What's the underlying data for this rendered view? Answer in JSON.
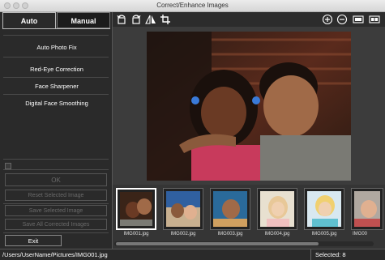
{
  "window": {
    "title": "Correct/Enhance Images"
  },
  "tabs": {
    "auto": "Auto",
    "manual": "Manual"
  },
  "corrections": {
    "auto_photo_fix": "Auto Photo Fix",
    "red_eye": "Red-Eye Correction",
    "face_sharpener": "Face Sharpener",
    "digital_face_smoothing": "Digital Face Smoothing"
  },
  "buttons": {
    "ok": "OK",
    "reset_selected": "Reset Selected Image",
    "save_selected": "Save Selected Image",
    "save_all": "Save All Corrected Images",
    "exit": "Exit"
  },
  "toolbar": {
    "icons": [
      "rotate-left-icon",
      "rotate-right-icon",
      "flip-icon",
      "crop-icon",
      "zoom-in-icon",
      "zoom-out-icon",
      "single-view-icon",
      "compare-view-icon"
    ]
  },
  "thumbnails": [
    {
      "label": "IMG001.jpg",
      "selected": true
    },
    {
      "label": "IMG002.jpg",
      "selected": false
    },
    {
      "label": "IMG003.jpg",
      "selected": false
    },
    {
      "label": "IMG004.jpg",
      "selected": false
    },
    {
      "label": "IMG005.jpg",
      "selected": false
    },
    {
      "label": "IMG00",
      "selected": false
    }
  ],
  "status": {
    "path": "/Users/UserName/Pictures/IMG001.jpg",
    "selected": "Selected: 8"
  }
}
